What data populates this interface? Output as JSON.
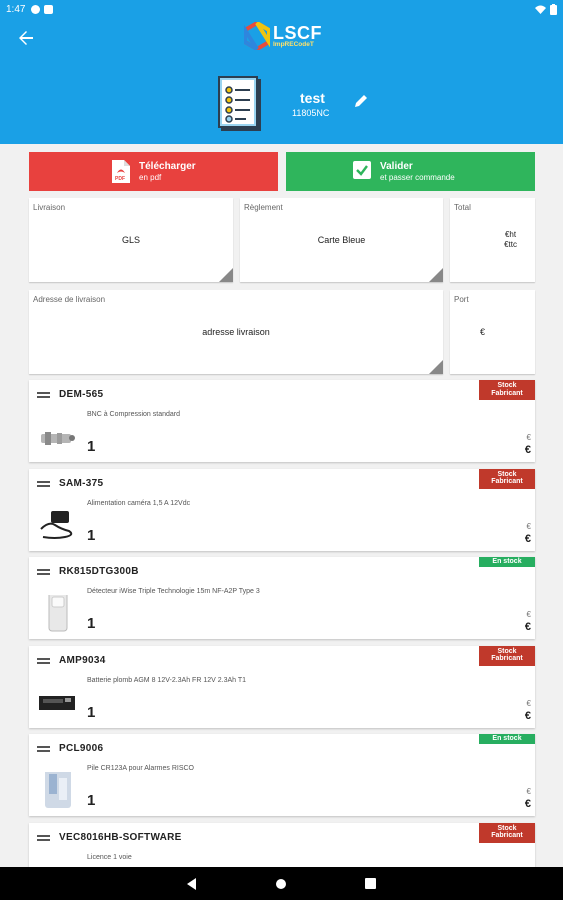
{
  "status_bar": {
    "time": "1:47"
  },
  "header": {
    "logo_name": "LSCF",
    "logo_sub": "ImpRECodeT",
    "order_name": "test",
    "order_ref": "11805NC"
  },
  "actions": {
    "download_label": "Télécharger",
    "download_sub": "en pdf",
    "validate_label": "Valider",
    "validate_sub": "et passer commande"
  },
  "fields": {
    "livraison": {
      "label": "Livraison",
      "value": "GLS"
    },
    "reglement": {
      "label": "Règlement",
      "value": "Carte Bleue"
    },
    "total": {
      "label": "Total",
      "ht": "€ht",
      "ttc": "€ttc"
    },
    "adresse": {
      "label": "Adresse de livraison",
      "value": "adresse livraison"
    },
    "port": {
      "label": "Port",
      "value": "€"
    }
  },
  "products": [
    {
      "ref": "DEM-565",
      "desc": "BNC à Compression standard",
      "qty": "1",
      "badge": "Stock\nFabricant",
      "unit": "€",
      "total": "€",
      "thumb": "bnc-connector"
    },
    {
      "ref": "SAM-375",
      "desc": "Alimentation caméra 1,5 A 12Vdc",
      "qty": "1",
      "badge": "Stock\nFabricant",
      "unit": "€",
      "total": "€",
      "thumb": "power-adapter"
    },
    {
      "ref": "RK815DTG300B",
      "desc": "Détecteur iWise Triple Technologie 15m NF-A2P Type 3",
      "qty": "1",
      "badge": "En stock",
      "unit": "€",
      "total": "€",
      "thumb": "motion-detector"
    },
    {
      "ref": "AMP9034",
      "desc": "Batterie plomb AGM 8 12V-2.3Ah FR 12V 2.3Ah T1",
      "qty": "1",
      "badge": "Stock\nFabricant",
      "unit": "€",
      "total": "€",
      "thumb": "battery"
    },
    {
      "ref": "PCL9006",
      "desc": "Pile CR123A pour Alarmes RISCO",
      "qty": "1",
      "badge": "En stock",
      "unit": "€",
      "total": "€",
      "thumb": "lithium-cell"
    },
    {
      "ref": "VEC8016HB-SOFTWARE",
      "desc": "Licence 1 voie",
      "qty": "",
      "badge": "Stock\nFabricant",
      "unit": "",
      "total": "",
      "thumb": "software-box"
    }
  ],
  "colors": {
    "primary": "#1aa0e6",
    "download": "#e8413e",
    "validate": "#2fb55c",
    "stock_badge": "#c0392b",
    "in_stock_badge": "#27ae60"
  }
}
